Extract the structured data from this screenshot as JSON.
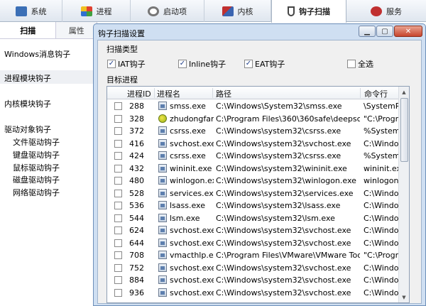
{
  "tabs": [
    {
      "label": "系统",
      "icon": "monitor-icon",
      "color": "#3b6fb6"
    },
    {
      "label": "进程",
      "icon": "windows-icon",
      "color": "#e0a020"
    },
    {
      "label": "启动项",
      "icon": "gear-icon",
      "color": "#666666"
    },
    {
      "label": "内核",
      "icon": "tools-icon",
      "color": "#3a64b0"
    },
    {
      "label": "钩子扫描",
      "icon": "hook-icon",
      "color": "#444444",
      "active": true
    },
    {
      "label": "服务",
      "icon": "service-icon",
      "color": "#c03030"
    }
  ],
  "sidebar": {
    "tab_scan": "扫描",
    "tab_attr": "属性",
    "items": {
      "windows_msg_hook": "Windows消息钩子",
      "process_module_hook": "进程模块钩子",
      "kernel_module_hook": "内核模块钩子",
      "driver_object_hook": "驱动对象钩子"
    },
    "sub_items": [
      "文件驱动钩子",
      "键盘驱动钩子",
      "鼠标驱动钩子",
      "磁盘驱动钩子",
      "网络驱动钩子"
    ]
  },
  "dialog": {
    "title": "钩子扫描设置",
    "scan_type_label": "扫描类型",
    "options": [
      {
        "label": "IAT钩子",
        "checked": true
      },
      {
        "label": "Inline钩子",
        "checked": true
      },
      {
        "label": "EAT钩子",
        "checked": true
      }
    ],
    "select_all_label": "全选",
    "select_all_checked": false,
    "target_label": "目标进程",
    "columns": [
      "进程ID",
      "进程名",
      "路径",
      "命令行"
    ],
    "rows": [
      {
        "pid": "288",
        "name": "smss.exe",
        "path": "C:\\Windows\\System32\\smss.exe",
        "cmd": "\\SystemR",
        "special": false
      },
      {
        "pid": "328",
        "name": "zhudongfan...",
        "path": "C:\\Program Files\\360\\360safe\\deepscan...",
        "cmd": "\"C:\\Progr",
        "special": true
      },
      {
        "pid": "372",
        "name": "csrss.exe",
        "path": "C:\\Windows\\system32\\csrss.exe",
        "cmd": "%SystemI",
        "special": false
      },
      {
        "pid": "416",
        "name": "svchost.exe",
        "path": "C:\\Windows\\system32\\svchost.exe",
        "cmd": "C:\\Windo",
        "special": false
      },
      {
        "pid": "424",
        "name": "csrss.exe",
        "path": "C:\\Windows\\system32\\csrss.exe",
        "cmd": "%SystemI",
        "special": false
      },
      {
        "pid": "432",
        "name": "wininit.exe",
        "path": "C:\\Windows\\system32\\wininit.exe",
        "cmd": "wininit.ex",
        "special": false
      },
      {
        "pid": "480",
        "name": "winlogon.exe",
        "path": "C:\\Windows\\system32\\winlogon.exe",
        "cmd": "winlogon.",
        "special": false
      },
      {
        "pid": "528",
        "name": "services.exe",
        "path": "C:\\Windows\\system32\\services.exe",
        "cmd": "C:\\Windo",
        "special": false
      },
      {
        "pid": "536",
        "name": "lsass.exe",
        "path": "C:\\Windows\\system32\\lsass.exe",
        "cmd": "C:\\Windo",
        "special": false
      },
      {
        "pid": "544",
        "name": "lsm.exe",
        "path": "C:\\Windows\\system32\\lsm.exe",
        "cmd": "C:\\Windo",
        "special": false
      },
      {
        "pid": "624",
        "name": "svchost.exe",
        "path": "C:\\Windows\\system32\\svchost.exe",
        "cmd": "C:\\Windo",
        "special": false
      },
      {
        "pid": "644",
        "name": "svchost.exe",
        "path": "C:\\Windows\\system32\\svchost.exe",
        "cmd": "C:\\Windo",
        "special": false
      },
      {
        "pid": "708",
        "name": "vmacthlp.exe",
        "path": "C:\\Program Files\\VMware\\VMware Tool...",
        "cmd": "\"C:\\Progr",
        "special": false
      },
      {
        "pid": "752",
        "name": "svchost.exe",
        "path": "C:\\Windows\\system32\\svchost.exe",
        "cmd": "C:\\Windo",
        "special": false
      },
      {
        "pid": "884",
        "name": "svchost.exe",
        "path": "C:\\Windows\\system32\\svchost.exe",
        "cmd": "C:\\Windo",
        "special": false
      },
      {
        "pid": "936",
        "name": "svchost.exe",
        "path": "C:\\Windows\\system32\\svchost.exe",
        "cmd": "C:\\Windo",
        "special": false
      }
    ]
  }
}
